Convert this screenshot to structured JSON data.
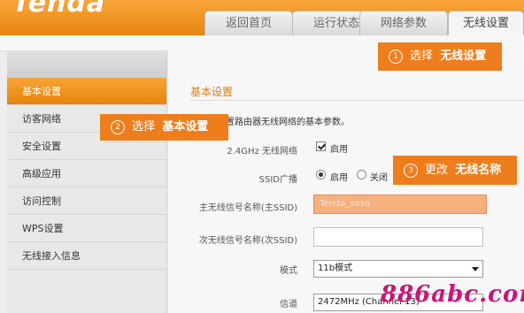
{
  "header": {
    "logo": "Tenda"
  },
  "tabs": [
    {
      "label": "返回首页"
    },
    {
      "label": "运行状态"
    },
    {
      "label": "网络参数"
    },
    {
      "label": "无线设置"
    }
  ],
  "sidebar": {
    "items": [
      {
        "label": "基本设置"
      },
      {
        "label": "访客网络"
      },
      {
        "label": "安全设置"
      },
      {
        "label": "高级应用"
      },
      {
        "label": "访问控制"
      },
      {
        "label": "WPS设置"
      },
      {
        "label": "无线接入信息"
      }
    ]
  },
  "main": {
    "section_title": "基本设置",
    "description": "置路由器无线网络的基本参数。",
    "fields": {
      "wireless_24": {
        "label": "2.4GHz 无线网络",
        "option": "启用"
      },
      "ssid_broadcast": {
        "label": "SSID广播",
        "on": "启用",
        "off": "关闭"
      },
      "primary_ssid": {
        "label": "主无线信号名称(主SSID)",
        "value": "Tenda_soso"
      },
      "secondary_ssid": {
        "label": "次无线信号名称(次SSID)",
        "value": ""
      },
      "mode": {
        "label": "模式",
        "value": "11b模式"
      },
      "channel": {
        "label": "信道",
        "value": "2472MHz (Channel 13)"
      }
    }
  },
  "callouts": [
    {
      "num": "1",
      "text": "选择",
      "bold": "无线设置"
    },
    {
      "num": "2",
      "text": "选择",
      "bold": "基本设置"
    },
    {
      "num": "3",
      "text": "更改",
      "bold": "无线名称"
    }
  ],
  "watermark": "886abc.com",
  "colors": {
    "accent": "#ee7d1c",
    "highlight": "#f6b07e",
    "watermark": "#c9147a"
  }
}
